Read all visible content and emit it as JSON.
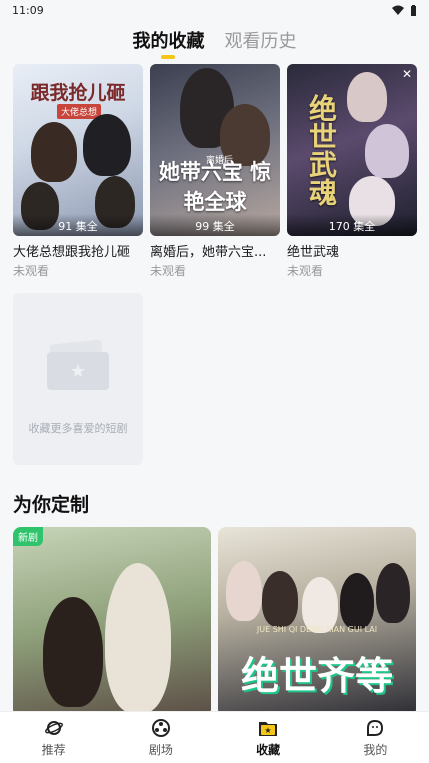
{
  "status_bar": {
    "time": "11:09",
    "wifi_icon": "wifi-icon",
    "battery_icon": "battery-icon"
  },
  "tabs": [
    {
      "label": "我的收藏",
      "active": true
    },
    {
      "label": "观看历史",
      "active": false
    }
  ],
  "favorites": [
    {
      "title": "大佬总想跟我抢儿砸",
      "status": "未观看",
      "episodes": "91 集全",
      "poster_text": "跟我抢儿砸",
      "poster_sub": "大佬总想"
    },
    {
      "title": "离婚后，她带六宝...",
      "status": "未观看",
      "episodes": "99 集全",
      "poster_text": "她带六宝 惊艳全球",
      "poster_sub": "离婚后"
    },
    {
      "title": "绝世武魂",
      "status": "未观看",
      "episodes": "170 集全",
      "poster_text": "绝世武魂"
    }
  ],
  "add_card": {
    "text": "收藏更多喜爱的短剧"
  },
  "recommend": {
    "title": "为你定制",
    "items": [
      {
        "badge": "新剧"
      },
      {
        "sub": "JUE SHI QI DENG XIAN GUI LAI",
        "poster_text": "绝世齐等"
      }
    ]
  },
  "bottom_nav": [
    {
      "label": "推荐",
      "icon": "planet-icon",
      "active": false
    },
    {
      "label": "剧场",
      "icon": "film-reel-icon",
      "active": false
    },
    {
      "label": "收藏",
      "icon": "folder-star-icon",
      "active": true
    },
    {
      "label": "我的",
      "icon": "face-icon",
      "active": false
    }
  ]
}
